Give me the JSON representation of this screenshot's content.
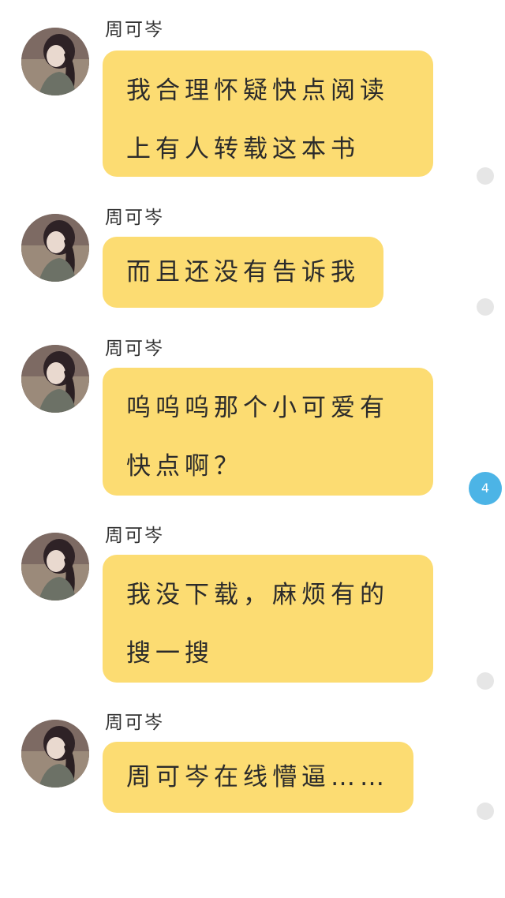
{
  "colors": {
    "bubble": "#fcdc72",
    "read_dot": "#e6e6e6",
    "unread_badge": "#4cb4e6",
    "background": "#ffffff"
  },
  "messages": [
    {
      "sender": "周可岑",
      "lines": [
        "我合理怀疑快点阅读",
        "上有人转载这本书"
      ],
      "status": "read"
    },
    {
      "sender": "周可岑",
      "lines": [
        "而且还没有告诉我"
      ],
      "status": "read"
    },
    {
      "sender": "周可岑",
      "lines": [
        "呜呜呜那个小可爱有",
        "快点啊？"
      ],
      "status": "unread",
      "unread_count": "4"
    },
    {
      "sender": "周可岑",
      "lines": [
        "我没下载，麻烦有的",
        "搜一搜"
      ],
      "status": "read"
    },
    {
      "sender": "周可岑",
      "lines": [
        "周可岑在线懵逼……"
      ],
      "status": "read"
    }
  ]
}
